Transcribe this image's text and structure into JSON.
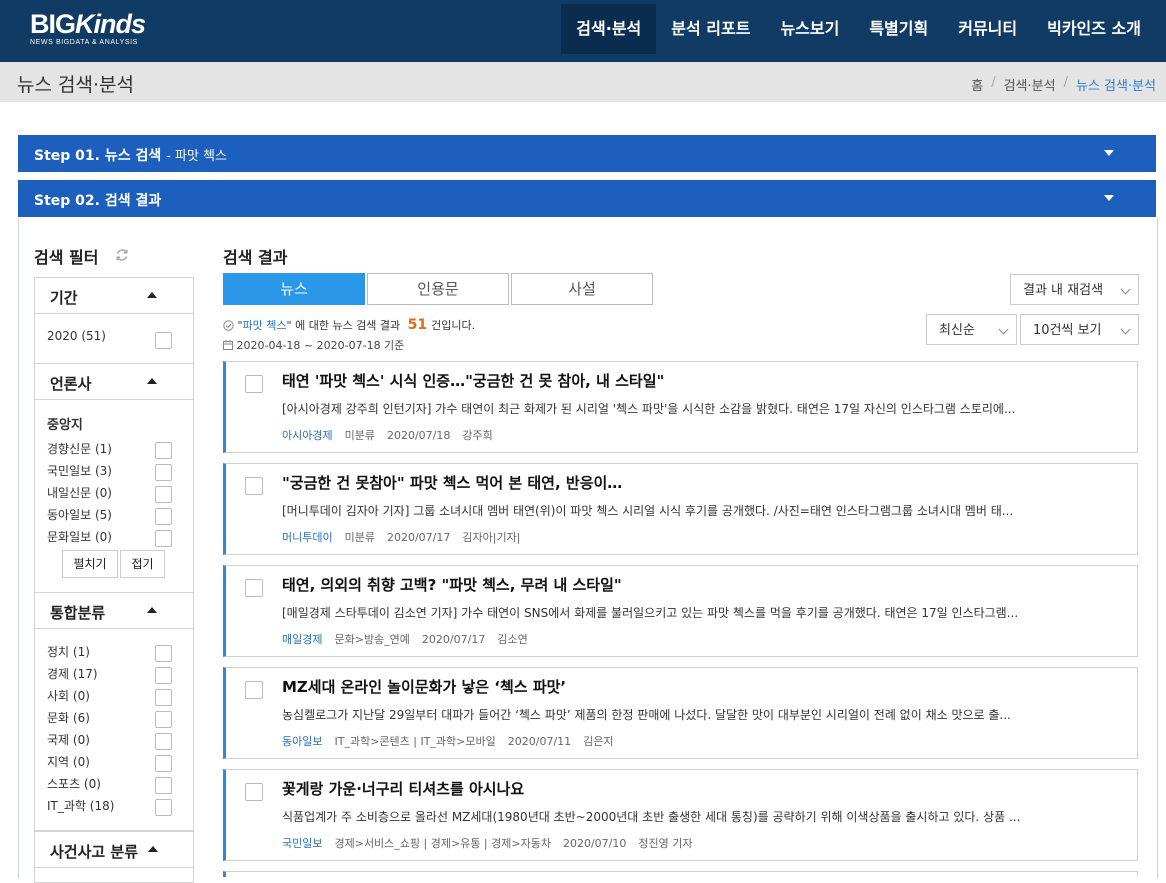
{
  "header": {
    "logo_main_1": "BIG",
    "logo_main_2": "Kinds",
    "logo_sub": "NEWS BIGDATA & ANALYSIS",
    "nav": [
      "검색·분석",
      "분석 리포트",
      "뉴스보기",
      "특별기획",
      "커뮤니티",
      "빅카인즈 소개"
    ]
  },
  "page": {
    "title": "뉴스 검색·분석",
    "breadcrumb": [
      "홈",
      "검색·분석",
      "뉴스 검색·분석"
    ],
    "sep": "/"
  },
  "steps": {
    "step1_label": "Step 01. 뉴스 검색",
    "step1_query": "- 파맛 첵스",
    "step2_label": "Step 02. 검색 결과"
  },
  "filter": {
    "title": "검색 필터",
    "period": {
      "head": "기간",
      "items": [
        "2020 (51)"
      ]
    },
    "press": {
      "head": "언론사",
      "subhead": "중앙지",
      "items": [
        "경향신문 (1)",
        "국민일보 (3)",
        "내일신문 (0)",
        "동아일보 (5)",
        "문화일보 (0)"
      ],
      "expand_label": "펼치기",
      "collapse_label": "접기"
    },
    "category": {
      "head": "통합분류",
      "items": [
        "정치 (1)",
        "경제 (17)",
        "사회 (0)",
        "문화 (6)",
        "국제 (0)",
        "지역 (0)",
        "스포츠 (0)",
        "IT_과학 (18)"
      ]
    },
    "incident": {
      "head": "사건사고 분류"
    }
  },
  "results": {
    "title": "검색 결과",
    "tabs": [
      "뉴스",
      "인용문",
      "사설"
    ],
    "search_within": "결과 내 재검색",
    "sort": "최신순",
    "page_size": "10건씩 보기",
    "summary_pre": "\"",
    "keyword": "파맛 첵스",
    "summary_mid": "\" 에 대한 뉴스 검색 결과",
    "count": "51",
    "summary_post": "건입니다.",
    "date_range": "2020-04-18 ~ 2020-07-18 기준",
    "articles": [
      {
        "title": "태연 '파맛 첵스' 시식 인증…\"궁금한 건 못 참아, 내 스타일\"",
        "desc": "[아시아경제 강주희 인턴기자] 가수 태연이 최근 화제가 된 시리얼 '첵스 파맛'을 시식한 소감을 밝혔다. 태연은 17일 자신의 인스타그램 스토리에...",
        "press": "아시아경제",
        "category": "미분류",
        "date": "2020/07/18",
        "author": "강주희"
      },
      {
        "title": "\"궁금한 건 못참아\" 파맛 첵스 먹어 본 태연, 반응이…",
        "desc": "[머니투데이 김자아 기자] 그룹 소녀시대 멤버 태연(위)이 파맛 첵스 시리얼 시식 후기를 공개했다. /사진=태연 인스타그램그룹 소녀시대 멤버 태...",
        "press": "머니투데이",
        "category": "미분류",
        "date": "2020/07/17",
        "author": "김자아|기자|"
      },
      {
        "title": "태연, 의외의 취향 고백? \"파맛 첵스, 무려 내 스타일\"",
        "desc": "[매일경제 스타투데이 김소연 기자] 가수 태연이 SNS에서 화제를 불러일으키고 있는 파맛 첵스를 먹을 후기를 공개했다. 태연은 17일 인스타그램...",
        "press": "매일경제",
        "category": "문화>방송_연예",
        "date": "2020/07/17",
        "author": "김소연"
      },
      {
        "title": "MZ세대 온라인 놀이문화가 낳은 ‘첵스 파맛’",
        "desc": "농심켈로그가 지난달 29일부터 대파가 들어간 ‘첵스 파맛’ 제품의 한정 판매에 나섰다. 달달한 맛이 대부분인 시리얼이 전례 없이 채소 맛으로 출...",
        "press": "동아일보",
        "category": "IT_과학>콘텐츠  |  IT_과학>모바일",
        "date": "2020/07/11",
        "author": "김은지"
      },
      {
        "title": "꽃게랑 가운·너구리 티셔츠를 아시나요",
        "desc": "식품업계가 주 소비층으로 올라선 MZ세대(1980년대 초반~2000년대 초반 출생한 세대 통칭)를 공략하기 위해 이색상품을 출시하고 있다. 상품 ...",
        "press": "국민일보",
        "category": "경제>서비스_쇼핑  |  경제>유통  |  경제>자동차",
        "date": "2020/07/10",
        "author": "정진영 기자"
      }
    ]
  }
}
